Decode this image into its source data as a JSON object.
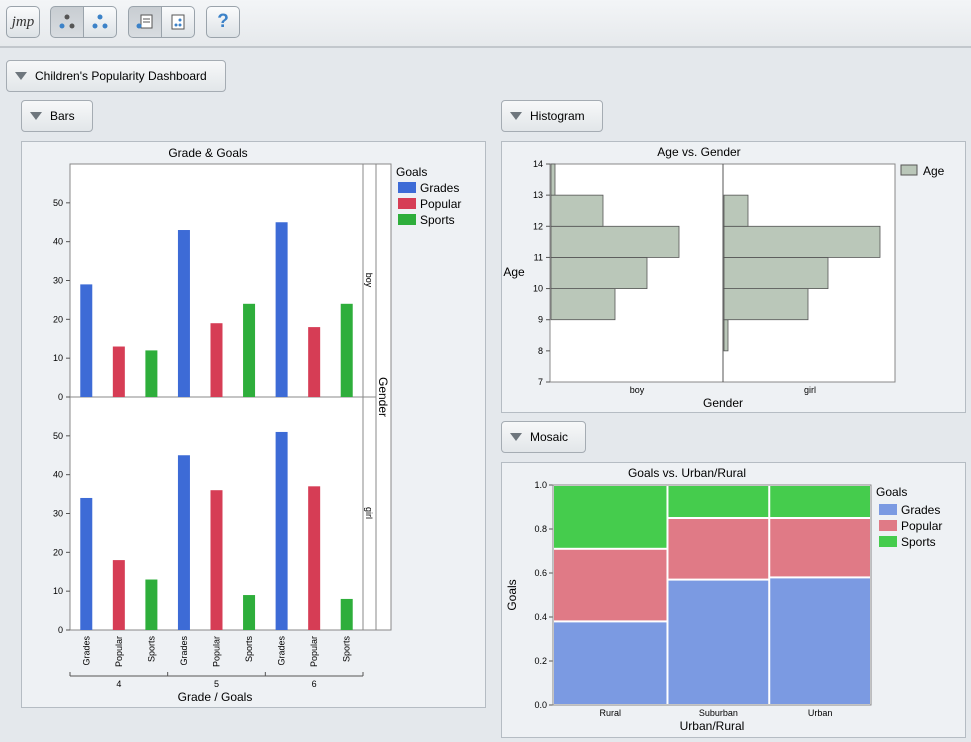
{
  "toolbar": {
    "logo_text": "jmp",
    "help_label": "?"
  },
  "dashboard": {
    "title": "Children's Popularity Dashboard"
  },
  "outlines": {
    "bars": "Bars",
    "histogram": "Histogram",
    "mosaic": "Mosaic"
  },
  "bars_chart": {
    "title": "Grade & Goals",
    "xlabel": "Grade / Goals",
    "panel_label": "Gender",
    "legend_title": "Goals",
    "legend": [
      {
        "name": "Grades",
        "color": "#3d6bd6"
      },
      {
        "name": "Popular",
        "color": "#d63d55"
      },
      {
        "name": "Sports",
        "color": "#2eae3b"
      }
    ],
    "grades": [
      "4",
      "5",
      "6"
    ],
    "goal_ticks": [
      "Grades",
      "Popular",
      "Sports"
    ],
    "y_ticks": [
      "0",
      "10",
      "20",
      "30",
      "40",
      "50"
    ],
    "panels": [
      {
        "label": "boy",
        "values": [
          29,
          13,
          12,
          43,
          19,
          24,
          45,
          18,
          24
        ]
      },
      {
        "label": "girl",
        "values": [
          34,
          18,
          13,
          45,
          36,
          9,
          51,
          37,
          8
        ]
      }
    ]
  },
  "hist_chart": {
    "title": "Age vs. Gender",
    "ylabel": "Age",
    "xlabel": "Gender",
    "legend": "Age",
    "fill": "#bac7b9",
    "y_ticks": [
      "7",
      "8",
      "9",
      "10",
      "11",
      "12",
      "13",
      "14"
    ],
    "groups": [
      {
        "label": "boy",
        "counts": [
          0,
          0,
          16,
          24,
          32,
          13,
          1
        ]
      },
      {
        "label": "girl",
        "counts": [
          0,
          1,
          21,
          26,
          39,
          6,
          0
        ]
      }
    ]
  },
  "mosaic_chart": {
    "title": "Goals vs. Urban/Rural",
    "ylabel": "Goals",
    "xlabel": "Urban/Rural",
    "legend_title": "Goals",
    "legend": [
      {
        "name": "Grades",
        "color": "#7b9ae2"
      },
      {
        "name": "Popular",
        "color": "#e07a86"
      },
      {
        "name": "Sports",
        "color": "#45cc4d"
      }
    ],
    "y_ticks": [
      "0.0",
      "0.2",
      "0.4",
      "0.6",
      "0.8",
      "1.0"
    ],
    "columns": [
      {
        "label": "Rural",
        "width": 0.36,
        "props": [
          0.38,
          0.33,
          0.29
        ]
      },
      {
        "label": "Suburban",
        "width": 0.32,
        "props": [
          0.57,
          0.28,
          0.15
        ]
      },
      {
        "label": "Urban",
        "width": 0.32,
        "props": [
          0.58,
          0.27,
          0.15
        ]
      }
    ]
  },
  "chart_data": [
    {
      "type": "bar",
      "title": "Grade & Goals",
      "xlabel": "Grade / Goals",
      "categories": [
        "4 Grades",
        "4 Popular",
        "4 Sports",
        "5 Grades",
        "5 Popular",
        "5 Sports",
        "6 Grades",
        "6 Popular",
        "6 Sports"
      ],
      "series": [
        {
          "name": "boy",
          "values": [
            29,
            13,
            12,
            43,
            19,
            24,
            45,
            18,
            24
          ]
        },
        {
          "name": "girl",
          "values": [
            34,
            18,
            13,
            45,
            36,
            9,
            51,
            37,
            8
          ]
        }
      ],
      "ylim": [
        0,
        60
      ]
    },
    {
      "type": "bar",
      "title": "Age vs. Gender",
      "xlabel": "Gender",
      "ylabel": "Age",
      "categories": [
        "7-8",
        "8-9",
        "9-10",
        "10-11",
        "11-12",
        "12-13",
        "13-14"
      ],
      "series": [
        {
          "name": "boy",
          "values": [
            0,
            0,
            16,
            24,
            32,
            13,
            1
          ]
        },
        {
          "name": "girl",
          "values": [
            0,
            1,
            21,
            26,
            39,
            6,
            0
          ]
        }
      ]
    },
    {
      "type": "bar",
      "title": "Goals vs. Urban/Rural",
      "xlabel": "Urban/Rural",
      "ylabel": "Goals",
      "categories": [
        "Rural",
        "Suburban",
        "Urban"
      ],
      "series": [
        {
          "name": "Grades",
          "values": [
            0.38,
            0.57,
            0.58
          ]
        },
        {
          "name": "Popular",
          "values": [
            0.33,
            0.28,
            0.27
          ]
        },
        {
          "name": "Sports",
          "values": [
            0.29,
            0.15,
            0.15
          ]
        }
      ],
      "ylim": [
        0,
        1
      ]
    }
  ]
}
